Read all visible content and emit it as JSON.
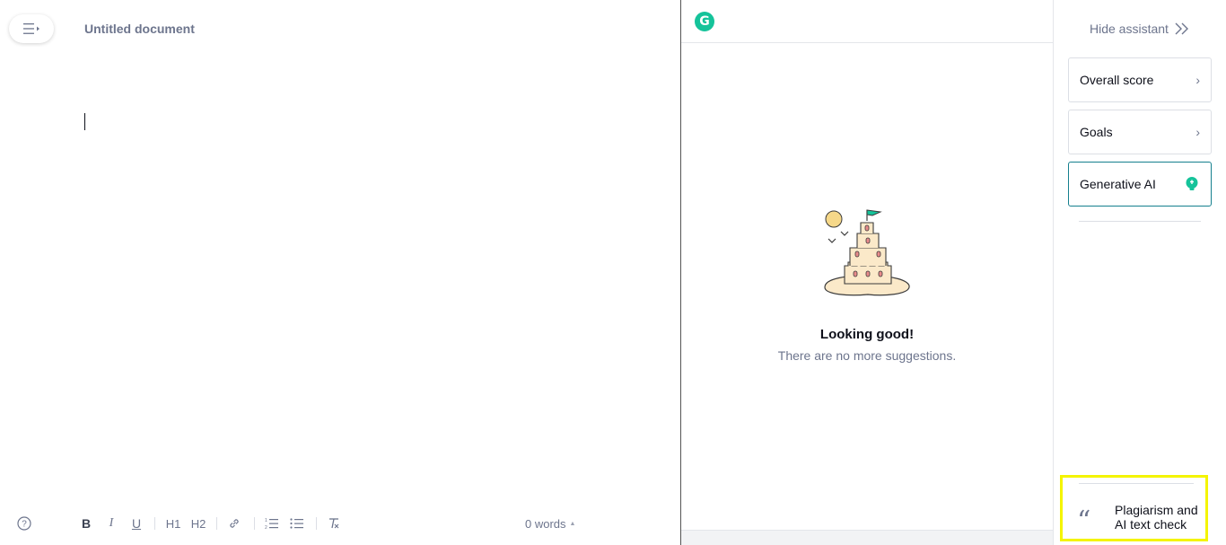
{
  "editor": {
    "title": "Untitled document",
    "word_count": "0 words",
    "toolbar": {
      "bold": "B",
      "italic": "I",
      "underline": "U",
      "h1": "H1",
      "h2": "H2"
    }
  },
  "suggestions": {
    "empty_title": "Looking good!",
    "empty_subtitle": "There are no more suggestions."
  },
  "assistant": {
    "hide_label": "Hide assistant",
    "cards": {
      "overall_score": "Overall score",
      "goals": "Goals",
      "generative_ai": "Generative AI"
    },
    "plagiarism": "Plagiarism and AI text check"
  },
  "colors": {
    "brand": "#15c39a",
    "accent_border": "#15808e",
    "highlight": "#f4f400"
  }
}
